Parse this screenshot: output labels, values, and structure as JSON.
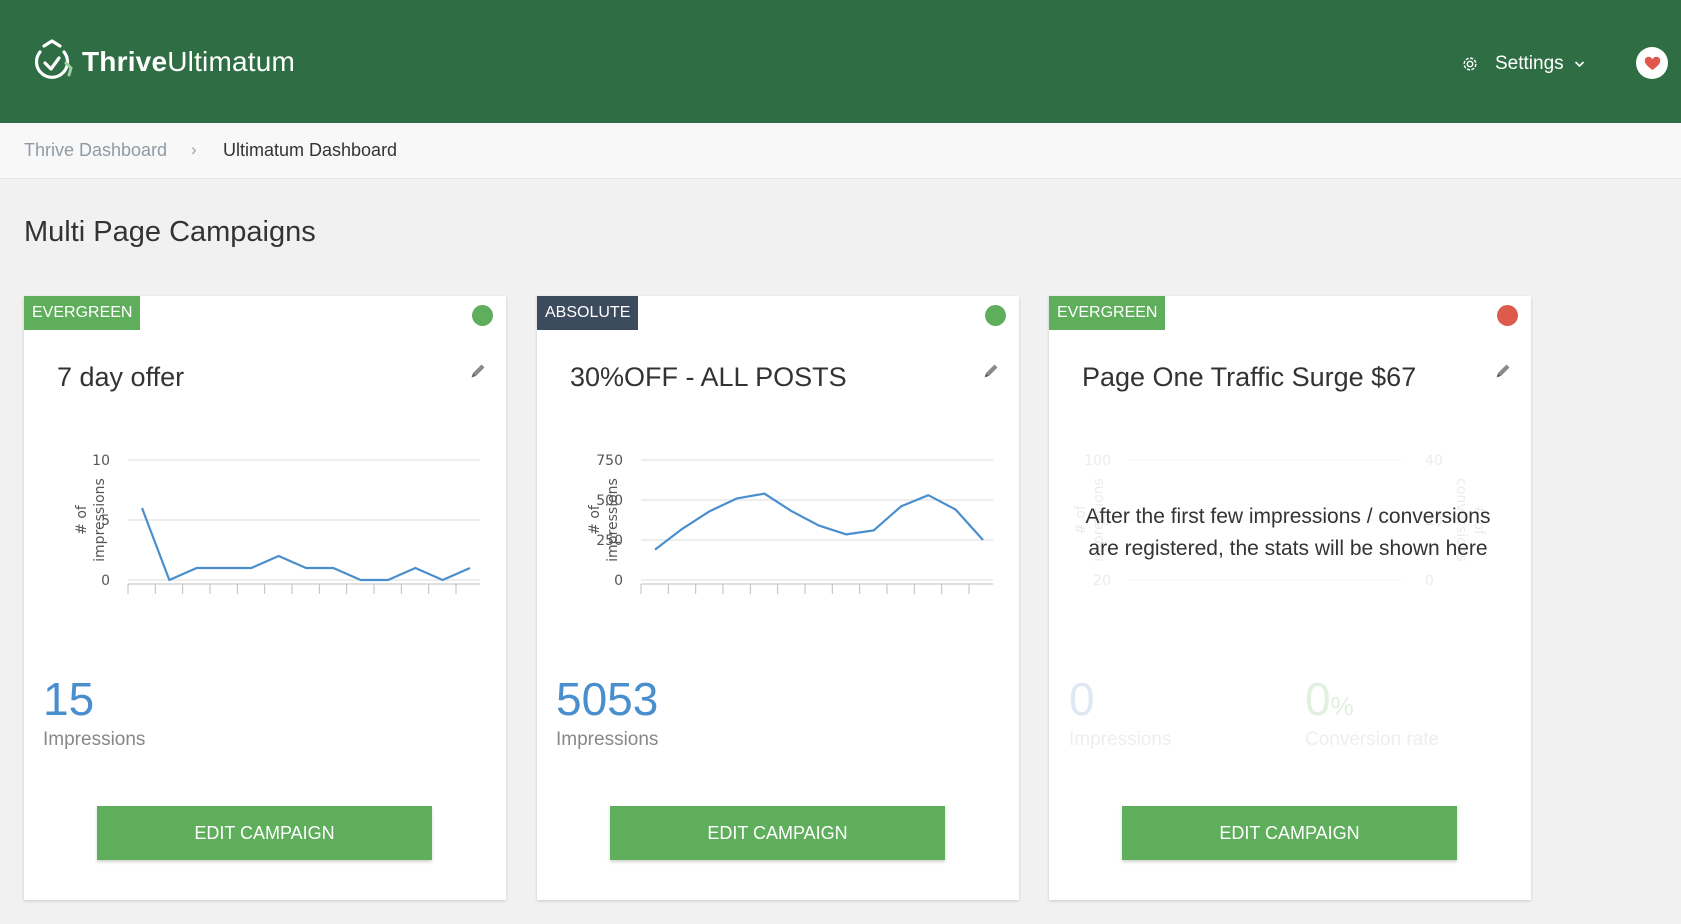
{
  "header": {
    "brand_bold": "Thrive",
    "brand_light": "Ultimatum",
    "settings_label": "Settings"
  },
  "breadcrumb": {
    "parent": "Thrive Dashboard",
    "separator": "›",
    "current": "Ultimatum Dashboard"
  },
  "section_title": "Multi Page Campaigns",
  "colors": {
    "header_bg": "#2f6e45",
    "evergreen_tag": "#5fae5c",
    "absolute_tag": "#3c4b5e",
    "status_active": "#5fae5c",
    "status_inactive": "#dc5b4c",
    "stat_blue": "#4a8fcd",
    "button_green": "#5fae5c",
    "line": "#4a8fcd"
  },
  "icons": {
    "brand": "thrive-clock-logo-icon",
    "settings": "gear-icon",
    "settings_caret": "chevron-down-icon",
    "heart": "heart-icon",
    "edit": "pencil-icon"
  },
  "cards": [
    {
      "tag": "EVERGREEN",
      "status": "active",
      "title": "7 day offer",
      "stat_value": "15",
      "stat_label": "Impressions",
      "button_label": "EDIT CAMPAIGN",
      "chart_data": {
        "type": "line",
        "title": "",
        "xlabel": "",
        "ylabel": "# of impressions",
        "ylim": [
          0,
          10
        ],
        "yticks": [
          "0",
          "5",
          "10"
        ],
        "grid": true,
        "series": [
          {
            "values": [
              6,
              0,
              1,
              1,
              1,
              2,
              1,
              1,
              0,
              0,
              1,
              0,
              1
            ]
          }
        ]
      }
    },
    {
      "tag": "ABSOLUTE",
      "status": "active",
      "title": "30%OFF - ALL POSTS",
      "stat_value": "5053",
      "stat_label": "Impressions",
      "button_label": "EDIT CAMPAIGN",
      "chart_data": {
        "type": "line",
        "title": "",
        "xlabel": "",
        "ylabel": "# of impressions",
        "ylim": [
          0,
          750
        ],
        "yticks": [
          "0",
          "250",
          "500",
          "750"
        ],
        "grid": true,
        "series": [
          {
            "values": [
              190,
              320,
              430,
              510,
              540,
              430,
              340,
              285,
              310,
              460,
              530,
              440,
              250
            ]
          }
        ]
      }
    },
    {
      "tag": "EVERGREEN",
      "status": "inactive",
      "title": "Page One Traffic Surge $67",
      "empty_message": "After the first few impressions / conversions are registered, the stats will be shown here",
      "stat_value": "0",
      "stat_label": "Impressions",
      "rate_value": "0",
      "rate_unit": "%",
      "rate_label": "Conversion rate",
      "button_label": "EDIT CAMPAIGN",
      "chart_data": {
        "type": "line",
        "title": "",
        "xlabel": "",
        "ylabel": "# of impressions",
        "y2label": "# of conversions",
        "ylim": [
          20,
          100
        ],
        "y2lim": [
          0,
          40
        ],
        "yticks": [
          "20",
          "60",
          "100"
        ],
        "y2ticks": [
          "0",
          "20",
          "40"
        ],
        "grid": true,
        "series": []
      }
    }
  ]
}
